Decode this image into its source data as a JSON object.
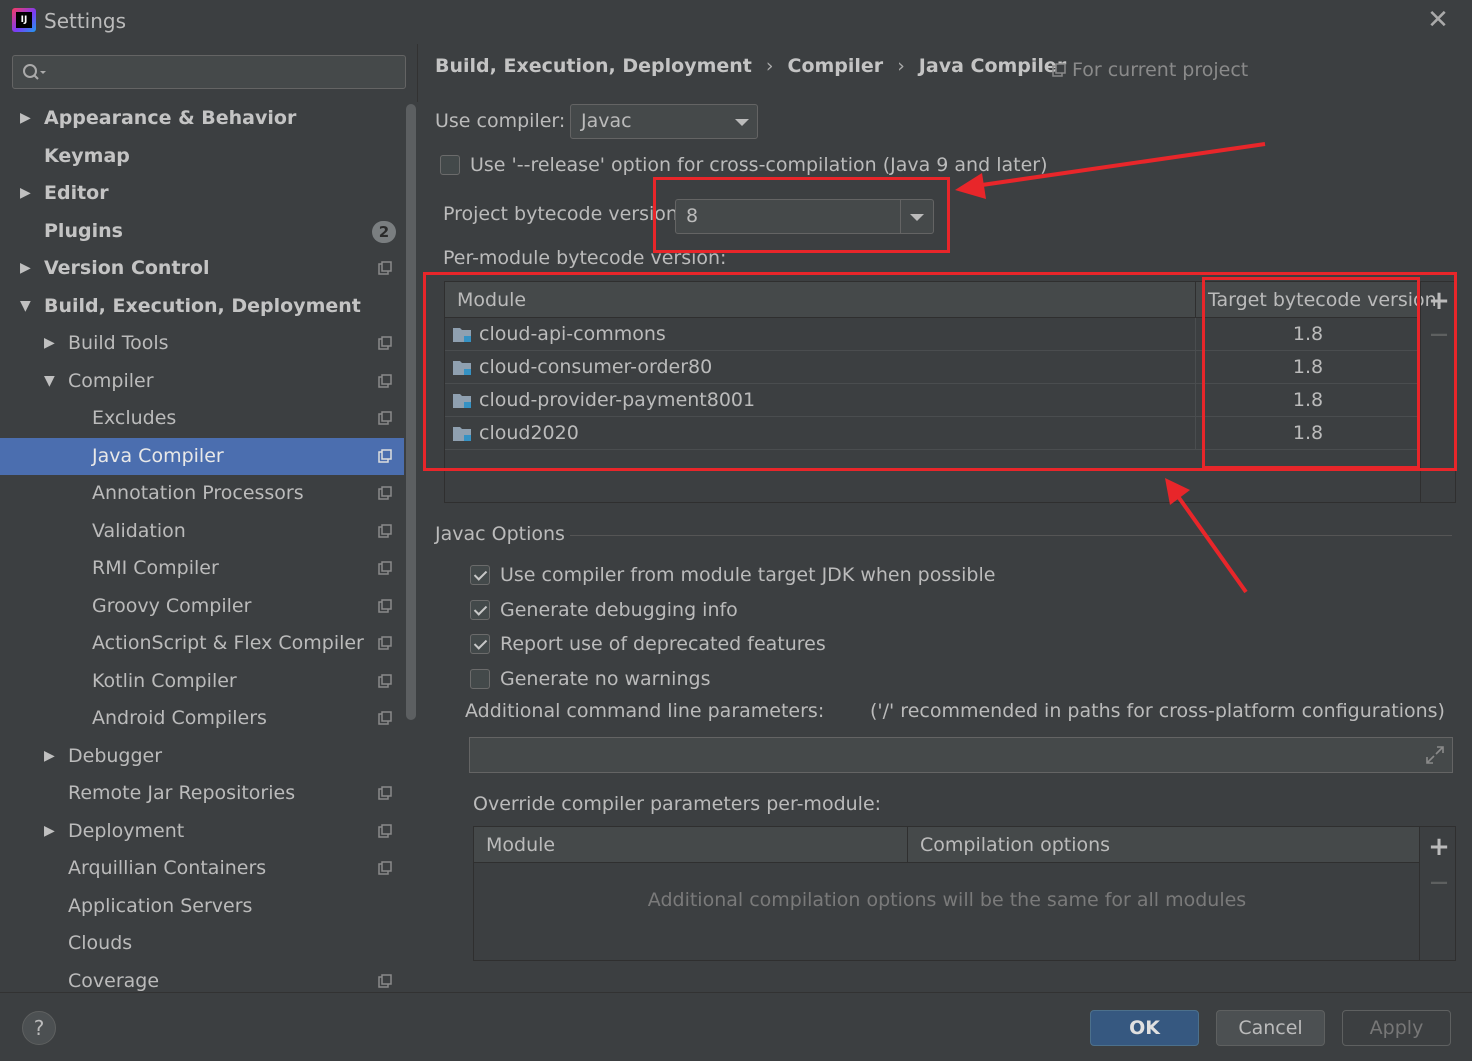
{
  "window": {
    "title": "Settings",
    "close_glyph": "✕"
  },
  "search": {
    "placeholder": "",
    "icon": "search-icon"
  },
  "sidebar": {
    "items": [
      {
        "label": "Appearance & Behavior",
        "level": 0,
        "arrow": "▶",
        "bold": true,
        "project": false
      },
      {
        "label": "Keymap",
        "level": 0,
        "arrow": "",
        "bold": true,
        "project": false
      },
      {
        "label": "Editor",
        "level": 0,
        "arrow": "▶",
        "bold": true,
        "project": false
      },
      {
        "label": "Plugins",
        "level": 0,
        "arrow": "",
        "bold": true,
        "badge": "2",
        "project": false
      },
      {
        "label": "Version Control",
        "level": 0,
        "arrow": "▶",
        "bold": true,
        "project": true
      },
      {
        "label": "Build, Execution, Deployment",
        "level": 0,
        "arrow": "▼",
        "bold": true,
        "project": false
      },
      {
        "label": "Build Tools",
        "level": 1,
        "arrow": "▶",
        "project": true
      },
      {
        "label": "Compiler",
        "level": 1,
        "arrow": "▼",
        "project": true
      },
      {
        "label": "Excludes",
        "level": 2,
        "arrow": "",
        "project": true
      },
      {
        "label": "Java Compiler",
        "level": 2,
        "arrow": "",
        "project": true,
        "selected": true
      },
      {
        "label": "Annotation Processors",
        "level": 2,
        "arrow": "",
        "project": true
      },
      {
        "label": "Validation",
        "level": 2,
        "arrow": "",
        "project": true
      },
      {
        "label": "RMI Compiler",
        "level": 2,
        "arrow": "",
        "project": true
      },
      {
        "label": "Groovy Compiler",
        "level": 2,
        "arrow": "",
        "project": true
      },
      {
        "label": "ActionScript & Flex Compiler",
        "level": 2,
        "arrow": "",
        "project": true
      },
      {
        "label": "Kotlin Compiler",
        "level": 2,
        "arrow": "",
        "project": true
      },
      {
        "label": "Android Compilers",
        "level": 2,
        "arrow": "",
        "project": true
      },
      {
        "label": "Debugger",
        "level": 1,
        "arrow": "▶",
        "project": false
      },
      {
        "label": "Remote Jar Repositories",
        "level": 1,
        "arrow": "",
        "project": true
      },
      {
        "label": "Deployment",
        "level": 1,
        "arrow": "▶",
        "project": true
      },
      {
        "label": "Arquillian Containers",
        "level": 1,
        "arrow": "",
        "project": true
      },
      {
        "label": "Application Servers",
        "level": 1,
        "arrow": "",
        "project": false
      },
      {
        "label": "Clouds",
        "level": 1,
        "arrow": "",
        "project": false
      },
      {
        "label": "Coverage",
        "level": 1,
        "arrow": "",
        "project": true
      }
    ]
  },
  "breadcrumb": {
    "items": [
      "Build, Execution, Deployment",
      "Compiler",
      "Java Compiler"
    ],
    "separator": "›",
    "scope": "For current project"
  },
  "compiler": {
    "use_compiler_label": "Use compiler:",
    "use_compiler_value": "Javac",
    "release_option_label": "Use '--release' option for cross-compilation (Java 9 and later)",
    "release_option_checked": false,
    "project_bytecode_label": "Project bytecode version:",
    "project_bytecode_value": "8",
    "per_module_label": "Per-module bytecode version:"
  },
  "module_table": {
    "columns": [
      "Module",
      "Target bytecode version"
    ],
    "rows": [
      {
        "module": "cloud-api-commons",
        "version": "1.8"
      },
      {
        "module": "cloud-consumer-order80",
        "version": "1.8"
      },
      {
        "module": "cloud-provider-payment8001",
        "version": "1.8"
      },
      {
        "module": "cloud2020",
        "version": "1.8"
      }
    ],
    "add_glyph": "+",
    "remove_glyph": "—"
  },
  "javac_options": {
    "title": "Javac Options",
    "checkboxes": [
      {
        "label": "Use compiler from module target JDK when possible",
        "checked": true
      },
      {
        "label": "Generate debugging info",
        "checked": true
      },
      {
        "label": "Report use of deprecated features",
        "checked": true
      },
      {
        "label": "Generate no warnings",
        "checked": false
      }
    ],
    "additional_params_label": "Additional command line parameters:",
    "additional_params_hint": "('/' recommended in paths for cross-platform configurations)",
    "additional_params_value": "",
    "override_label": "Override compiler parameters per-module:",
    "override_columns": [
      "Module",
      "Compilation options"
    ],
    "override_empty_text": "Additional compilation options will be the same for all modules"
  },
  "footer": {
    "help_label": "?",
    "ok_label": "OK",
    "cancel_label": "Cancel",
    "apply_label": "Apply"
  },
  "colors": {
    "background": "#3c3f41",
    "selection": "#4b6eaf",
    "annotation_red": "#e8262a",
    "ok_button": "#365880"
  }
}
